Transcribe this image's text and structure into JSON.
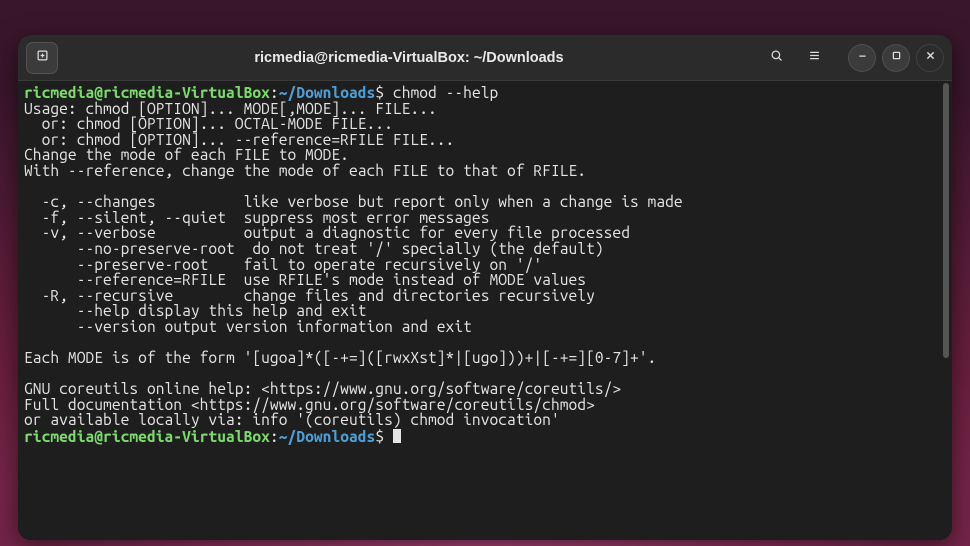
{
  "window": {
    "title": "ricmedia@ricmedia-VirtualBox: ~/Downloads"
  },
  "titlebar_icons": {
    "new_tab": "new-tab-icon",
    "search": "search-icon",
    "menu": "hamburger-menu-icon",
    "min": "minimize-icon",
    "max": "maximize-icon",
    "close": "close-icon"
  },
  "prompt": {
    "user_host": "ricmedia@ricmedia-VirtualBox",
    "sep": ":",
    "path": "~/Downloads",
    "sigil": "$ "
  },
  "lines": {
    "cmd1": "chmod --help",
    "u01": "Usage: chmod [OPTION]... MODE[,MODE]... FILE...",
    "u02": "  or: chmod [OPTION]... OCTAL-MODE FILE...",
    "u03": "  or: chmod [OPTION]... --reference=RFILE FILE...",
    "u04": "Change the mode of each FILE to MODE.",
    "u05": "With --reference, change the mode of each FILE to that of RFILE.",
    "u06": "",
    "u07": "  -c, --changes          like verbose but report only when a change is made",
    "u08": "  -f, --silent, --quiet  suppress most error messages",
    "u09": "  -v, --verbose          output a diagnostic for every file processed",
    "u10": "      --no-preserve-root  do not treat '/' specially (the default)",
    "u11": "      --preserve-root    fail to operate recursively on '/'",
    "u12": "      --reference=RFILE  use RFILE's mode instead of MODE values",
    "u13": "  -R, --recursive        change files and directories recursively",
    "u14": "      --help display this help and exit",
    "u15": "      --version output version information and exit",
    "u16": "",
    "u17": "Each MODE is of the form '[ugoa]*([-+=]([rwxXst]*|[ugo]))+|[-+=][0-7]+'.",
    "u18": "",
    "u19": "GNU coreutils online help: <https://www.gnu.org/software/coreutils/>",
    "u20": "Full documentation <https://www.gnu.org/software/coreutils/chmod>",
    "u21": "or available locally via: info '(coreutils) chmod invocation'"
  }
}
